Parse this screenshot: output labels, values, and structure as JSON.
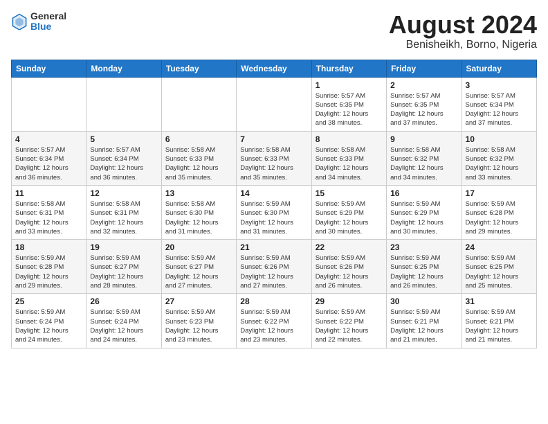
{
  "header": {
    "logo_general": "General",
    "logo_blue": "Blue",
    "month_year": "August 2024",
    "location": "Benisheikh, Borno, Nigeria"
  },
  "days_of_week": [
    "Sunday",
    "Monday",
    "Tuesday",
    "Wednesday",
    "Thursday",
    "Friday",
    "Saturday"
  ],
  "weeks": [
    [
      {
        "day": "",
        "info": ""
      },
      {
        "day": "",
        "info": ""
      },
      {
        "day": "",
        "info": ""
      },
      {
        "day": "",
        "info": ""
      },
      {
        "day": "1",
        "info": "Sunrise: 5:57 AM\nSunset: 6:35 PM\nDaylight: 12 hours\nand 38 minutes."
      },
      {
        "day": "2",
        "info": "Sunrise: 5:57 AM\nSunset: 6:35 PM\nDaylight: 12 hours\nand 37 minutes."
      },
      {
        "day": "3",
        "info": "Sunrise: 5:57 AM\nSunset: 6:34 PM\nDaylight: 12 hours\nand 37 minutes."
      }
    ],
    [
      {
        "day": "4",
        "info": "Sunrise: 5:57 AM\nSunset: 6:34 PM\nDaylight: 12 hours\nand 36 minutes."
      },
      {
        "day": "5",
        "info": "Sunrise: 5:57 AM\nSunset: 6:34 PM\nDaylight: 12 hours\nand 36 minutes."
      },
      {
        "day": "6",
        "info": "Sunrise: 5:58 AM\nSunset: 6:33 PM\nDaylight: 12 hours\nand 35 minutes."
      },
      {
        "day": "7",
        "info": "Sunrise: 5:58 AM\nSunset: 6:33 PM\nDaylight: 12 hours\nand 35 minutes."
      },
      {
        "day": "8",
        "info": "Sunrise: 5:58 AM\nSunset: 6:33 PM\nDaylight: 12 hours\nand 34 minutes."
      },
      {
        "day": "9",
        "info": "Sunrise: 5:58 AM\nSunset: 6:32 PM\nDaylight: 12 hours\nand 34 minutes."
      },
      {
        "day": "10",
        "info": "Sunrise: 5:58 AM\nSunset: 6:32 PM\nDaylight: 12 hours\nand 33 minutes."
      }
    ],
    [
      {
        "day": "11",
        "info": "Sunrise: 5:58 AM\nSunset: 6:31 PM\nDaylight: 12 hours\nand 33 minutes."
      },
      {
        "day": "12",
        "info": "Sunrise: 5:58 AM\nSunset: 6:31 PM\nDaylight: 12 hours\nand 32 minutes."
      },
      {
        "day": "13",
        "info": "Sunrise: 5:58 AM\nSunset: 6:30 PM\nDaylight: 12 hours\nand 31 minutes."
      },
      {
        "day": "14",
        "info": "Sunrise: 5:59 AM\nSunset: 6:30 PM\nDaylight: 12 hours\nand 31 minutes."
      },
      {
        "day": "15",
        "info": "Sunrise: 5:59 AM\nSunset: 6:29 PM\nDaylight: 12 hours\nand 30 minutes."
      },
      {
        "day": "16",
        "info": "Sunrise: 5:59 AM\nSunset: 6:29 PM\nDaylight: 12 hours\nand 30 minutes."
      },
      {
        "day": "17",
        "info": "Sunrise: 5:59 AM\nSunset: 6:28 PM\nDaylight: 12 hours\nand 29 minutes."
      }
    ],
    [
      {
        "day": "18",
        "info": "Sunrise: 5:59 AM\nSunset: 6:28 PM\nDaylight: 12 hours\nand 29 minutes."
      },
      {
        "day": "19",
        "info": "Sunrise: 5:59 AM\nSunset: 6:27 PM\nDaylight: 12 hours\nand 28 minutes."
      },
      {
        "day": "20",
        "info": "Sunrise: 5:59 AM\nSunset: 6:27 PM\nDaylight: 12 hours\nand 27 minutes."
      },
      {
        "day": "21",
        "info": "Sunrise: 5:59 AM\nSunset: 6:26 PM\nDaylight: 12 hours\nand 27 minutes."
      },
      {
        "day": "22",
        "info": "Sunrise: 5:59 AM\nSunset: 6:26 PM\nDaylight: 12 hours\nand 26 minutes."
      },
      {
        "day": "23",
        "info": "Sunrise: 5:59 AM\nSunset: 6:25 PM\nDaylight: 12 hours\nand 26 minutes."
      },
      {
        "day": "24",
        "info": "Sunrise: 5:59 AM\nSunset: 6:25 PM\nDaylight: 12 hours\nand 25 minutes."
      }
    ],
    [
      {
        "day": "25",
        "info": "Sunrise: 5:59 AM\nSunset: 6:24 PM\nDaylight: 12 hours\nand 24 minutes."
      },
      {
        "day": "26",
        "info": "Sunrise: 5:59 AM\nSunset: 6:24 PM\nDaylight: 12 hours\nand 24 minutes."
      },
      {
        "day": "27",
        "info": "Sunrise: 5:59 AM\nSunset: 6:23 PM\nDaylight: 12 hours\nand 23 minutes."
      },
      {
        "day": "28",
        "info": "Sunrise: 5:59 AM\nSunset: 6:22 PM\nDaylight: 12 hours\nand 23 minutes."
      },
      {
        "day": "29",
        "info": "Sunrise: 5:59 AM\nSunset: 6:22 PM\nDaylight: 12 hours\nand 22 minutes."
      },
      {
        "day": "30",
        "info": "Sunrise: 5:59 AM\nSunset: 6:21 PM\nDaylight: 12 hours\nand 21 minutes."
      },
      {
        "day": "31",
        "info": "Sunrise: 5:59 AM\nSunset: 6:21 PM\nDaylight: 12 hours\nand 21 minutes."
      }
    ]
  ]
}
